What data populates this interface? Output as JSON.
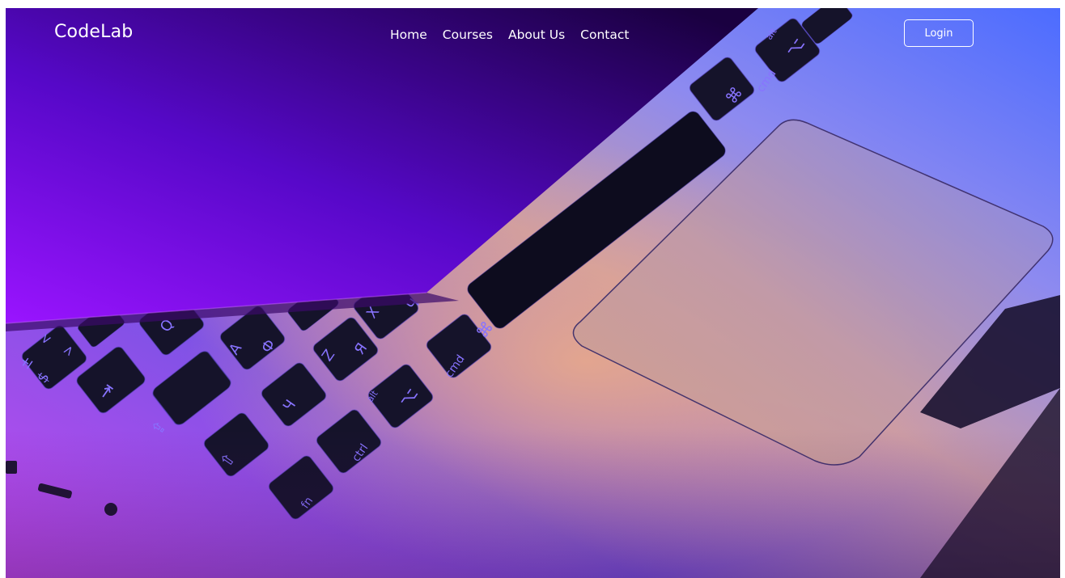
{
  "brand": {
    "name": "CodeLab"
  },
  "nav": {
    "items": [
      {
        "label": "Home"
      },
      {
        "label": "Courses"
      },
      {
        "label": "About Us"
      },
      {
        "label": "Contact"
      }
    ]
  },
  "login": {
    "label": "Login"
  },
  "hero": {
    "image_subject": "laptop-keyboard-trackpad-photo",
    "colors": {
      "purple": "#8a12f2",
      "deep_indigo": "#23004a",
      "blue": "#3a5bff",
      "peach": "#d9a38e",
      "key_black": "#141428"
    },
    "key_glyphs": [
      "⌘",
      "cmd",
      "⌥",
      "alt",
      "fn",
      "ctrl",
      "⇧",
      "⇪",
      "⇥",
      "Ф",
      "А",
      "Я",
      "Ч",
      "Х",
      "Z",
      "Q",
      "$",
      "±",
      "<",
      ">"
    ]
  }
}
